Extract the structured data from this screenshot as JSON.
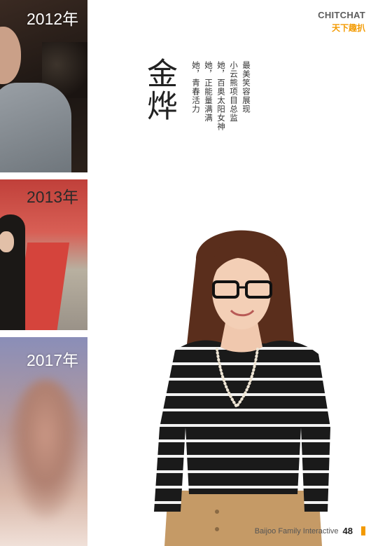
{
  "brand": {
    "en": "CHITCHAT",
    "cn": "天下趣扒"
  },
  "timeline": [
    {
      "year": "2012年"
    },
    {
      "year": "2013年"
    },
    {
      "year": "2017年"
    }
  ],
  "profile": {
    "name": "金烨",
    "lines": [
      "最美笑容展现",
      "小云熊项目总监",
      "她，百奥太阳女神",
      "她，正能量满满",
      "她，青春活力"
    ]
  },
  "footer": {
    "text": "Baijoo Family Interactive",
    "page": "48"
  },
  "colors": {
    "accent": "#f39a00",
    "text": "#333333"
  }
}
